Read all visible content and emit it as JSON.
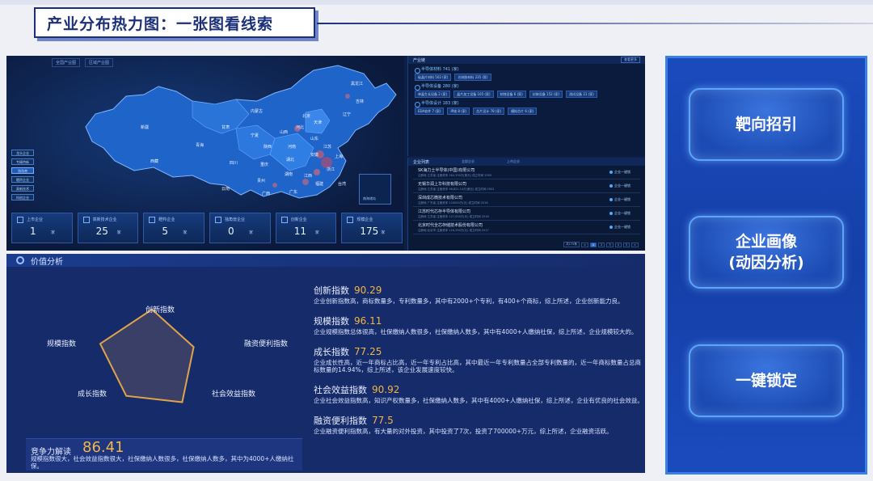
{
  "slide": {
    "title": "产业分布热力图：一张图看线索"
  },
  "dashboard": {
    "map_tabs": [
      "全国产业图",
      "区域产业图"
    ],
    "map_labels": [
      "黑龙江",
      "吉林",
      "辽宁",
      "内蒙古",
      "北京",
      "天津",
      "河北",
      "山西",
      "宁夏",
      "甘肃",
      "新疆",
      "西藏",
      "青海",
      "四川",
      "陕西",
      "河南",
      "山东",
      "安徽",
      "湖北",
      "重庆",
      "江苏",
      "上海",
      "浙江",
      "湖南",
      "江西",
      "贵州",
      "云南",
      "广西",
      "广东",
      "福建",
      "台湾"
    ],
    "side_buttons": [
      "龙头企业",
      "专精特新",
      "独角兽",
      "瞪羚企业",
      "高新技术",
      "科创企业"
    ],
    "inset_label": "南海诸岛",
    "stats": [
      {
        "label": "上市企业",
        "value": "1",
        "unit": "家",
        "icon": "building-icon"
      },
      {
        "label": "高新技术企业",
        "value": "25",
        "unit": "家",
        "icon": "chart-icon"
      },
      {
        "label": "瞪羚企业",
        "value": "5",
        "unit": "家",
        "icon": "triangle-icon"
      },
      {
        "label": "独角兽企业",
        "value": "0",
        "unit": "家",
        "icon": "horse-icon"
      },
      {
        "label": "创新企业",
        "value": "11",
        "unit": "家",
        "icon": "grid-icon"
      },
      {
        "label": "规模企业",
        "value": "175",
        "unit": "家",
        "icon": "factory-icon"
      }
    ],
    "chain": {
      "title": "产业链",
      "more": "查看更多",
      "groups": [
        {
          "title": "半导体材料 741 (家)",
          "chips": [
            "硅晶片材料 502 (家)",
            "光刻胶材料 235 (家)"
          ]
        },
        {
          "title": "半导体设备 280 (家)",
          "chips": [
            "单晶生长设备 2 (家)",
            "晶片加工设备 105 (家)",
            "刻蚀设备 6 (家)",
            "封装设备 152 (家)",
            "测试设备 21 (家)"
          ]
        },
        {
          "title": "半导体设计 183 (家)",
          "chips": [
            "EDA软件 7 (家)",
            "IP核 8 (家)",
            "芯片设计 78 (家)",
            "模拟芯片 6 (家)"
          ]
        }
      ]
    },
    "company_list": {
      "title": "企业列表",
      "tabs": [
        "全部企业",
        "上市企业"
      ],
      "rows": [
        {
          "name": "SK海力士半导体(中国)有限公司",
          "meta": "注册地 江苏省  注册资本 284,330万(美元)  成立时间 2005",
          "action": "企业一键锁"
        },
        {
          "name": "无锡华润上华科技有限公司",
          "meta": "注册地 江苏省  注册资本 98,821.14万(美元)  成立时间 2002",
          "action": "企业一键锁"
        },
        {
          "name": "深圳成芯微技术有限公司",
          "meta": "注册地 广东省  注册资本 120000万(元)  成立时间 2016",
          "action": "企业一键锁"
        },
        {
          "name": "江苏时代芯存半导体有限公司",
          "meta": "注册地 江苏省  注册资本 127,000万(元)  成立时间 2016",
          "action": "企业一键锁"
        },
        {
          "name": "北京时代全芯存储技术股份有限公司",
          "meta": "注册地 北京市  注册资本 116,390万(元)  成立时间 2017",
          "action": "企业一键锁"
        }
      ],
      "pager": [
        "共175条",
        "<",
        "1",
        "2",
        "3",
        "4",
        "5",
        ">"
      ]
    }
  },
  "value_analysis": {
    "title": "价值分析",
    "radar_labels": {
      "top": "创新指数",
      "right": "融资便利指数",
      "bottom_right": "社会效益指数",
      "bottom_left": "成长指数",
      "left": "规模指数"
    },
    "radar_values": {
      "innovation": 90.29,
      "financing": 77.5,
      "social": 90.92,
      "growth": 77.25,
      "scale": 96.11
    },
    "score": {
      "label": "竞争力解读",
      "value": "86.41",
      "desc": "规模指数很大，社会效益指数很大，社保缴纳人数很多，社保缴纳人数多，其中为4000+人缴纳社保。"
    },
    "metrics": [
      {
        "name": "创新指数",
        "score": "90.29",
        "desc": "企业创新指数高，商标数量多，专利数量多，其中有2000+个专利，有400+个商标，综上所述，企业创新能力良。"
      },
      {
        "name": "规模指数",
        "score": "96.11",
        "desc": "企业规模指数总体很高，社保缴纳人数很多，社保缴纳人数多，其中有4000+人缴纳社保，综上所述，企业规模较大的。"
      },
      {
        "name": "成长指数",
        "score": "77.25",
        "desc": "企业成长性高，近一年商标占比高，近一年专利占比高，其中最近一年专利数量占全部专利数量的，近一年商标数量占总商标数量的14.94%，综上所述，该企业发展速度较快。"
      },
      {
        "name": "社会效益指数",
        "score": "90.92",
        "desc": "企业社会效益指数高，知识产权数量多，社保缴纳人数多，其中有4000+人缴纳社保，综上所述，企业有优良的社会效益。"
      },
      {
        "name": "融资便利指数",
        "score": "77.5",
        "desc": "企业融资便利指数高，有大量的对外投资，其中投资了7次，投资了700000+万元，综上所述，企业融资活跃。"
      }
    ]
  },
  "actions": [
    {
      "label": "靶向招引"
    },
    {
      "label": "企业画像\n(动因分析)"
    },
    {
      "label": "一键锁定"
    }
  ],
  "colors": {
    "accent": "#f2b644",
    "panel": "#1a4bbd",
    "title": "#1c2f7a"
  }
}
